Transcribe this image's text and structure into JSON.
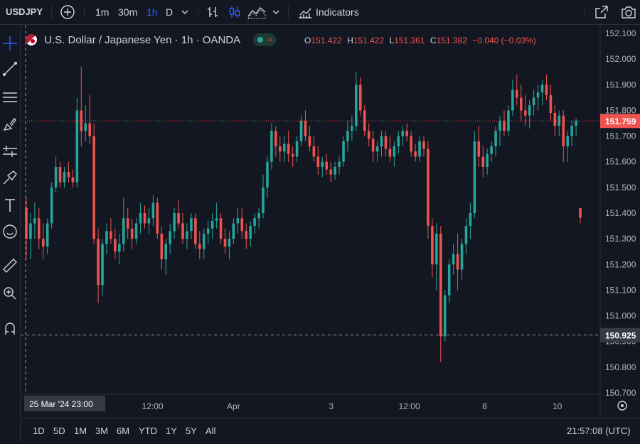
{
  "toolbar": {
    "symbol": "USDJPY",
    "intervals": [
      "1m",
      "30m",
      "1h",
      "D"
    ],
    "active_interval": "1h",
    "indicators_label": "Indicators"
  },
  "legend": {
    "title": "U.S. Dollar / Japanese Yen · 1h · OANDA",
    "o_label": "O",
    "o_value": "151.422",
    "h_label": "H",
    "h_value": "151.422",
    "l_label": "L",
    "l_value": "151.361",
    "c_label": "C",
    "c_value": "151.382",
    "change": "−0.040 (−0.03%)",
    "badge_icon": "≈"
  },
  "bottombar": {
    "ranges": [
      "1D",
      "5D",
      "1M",
      "3M",
      "6M",
      "YTD",
      "1Y",
      "5Y",
      "All"
    ],
    "clock": "21:57:08 (UTC)"
  },
  "colors": {
    "background": "#131722",
    "up": "#26a69a",
    "down": "#ef5350",
    "text": "#d1d4dc",
    "accent": "#2962ff"
  },
  "chart_data": {
    "type": "candlestick",
    "symbol": "USDJPY",
    "interval": "1h",
    "ylim": [
      150.7,
      152.1
    ],
    "yticks": [
      "152.100",
      "152.000",
      "151.900",
      "151.800",
      "151.700",
      "151.600",
      "151.500",
      "151.400",
      "151.300",
      "151.200",
      "151.100",
      "151.000",
      "150.900",
      "150.800",
      "150.700"
    ],
    "xticks": [
      "12:00",
      "Apr",
      "3",
      "12:00",
      "8",
      "10"
    ],
    "crosshair_x_label": "25 Mar '24  23:00",
    "crosshair_y_label": "150.925",
    "crosshair_price": 150.925,
    "last_price_label": "151.759",
    "last_price": 151.759,
    "grid": false,
    "candles": [
      [
        151.42,
        151.46,
        151.22,
        151.3
      ],
      [
        151.3,
        151.4,
        151.22,
        151.36
      ],
      [
        151.36,
        151.44,
        151.3,
        151.38
      ],
      [
        151.38,
        151.42,
        151.26,
        151.3
      ],
      [
        151.3,
        151.36,
        151.22,
        151.27
      ],
      [
        151.27,
        151.38,
        151.24,
        151.36
      ],
      [
        151.36,
        151.52,
        151.34,
        151.5
      ],
      [
        151.5,
        151.62,
        151.48,
        151.58
      ],
      [
        151.58,
        151.6,
        151.5,
        151.52
      ],
      [
        151.52,
        151.58,
        151.5,
        151.56
      ],
      [
        151.56,
        151.6,
        151.52,
        151.54
      ],
      [
        151.54,
        151.57,
        151.5,
        151.52
      ],
      [
        151.52,
        151.85,
        151.5,
        151.8
      ],
      [
        151.8,
        151.97,
        151.66,
        151.72
      ],
      [
        151.72,
        151.82,
        151.68,
        151.75
      ],
      [
        151.75,
        151.86,
        151.67,
        151.7
      ],
      [
        151.7,
        151.75,
        151.28,
        151.3
      ],
      [
        151.3,
        151.34,
        151.05,
        151.12
      ],
      [
        151.12,
        151.3,
        151.08,
        151.28
      ],
      [
        151.28,
        151.36,
        151.24,
        151.33
      ],
      [
        151.33,
        151.38,
        151.28,
        151.3
      ],
      [
        151.3,
        151.34,
        151.22,
        151.25
      ],
      [
        151.25,
        151.32,
        151.2,
        151.28
      ],
      [
        151.28,
        151.46,
        151.25,
        151.38
      ],
      [
        151.38,
        151.42,
        151.3,
        151.34
      ],
      [
        151.34,
        151.38,
        151.26,
        151.3
      ],
      [
        151.3,
        151.38,
        151.28,
        151.36
      ],
      [
        151.36,
        151.44,
        151.32,
        151.4
      ],
      [
        151.4,
        151.43,
        151.34,
        151.36
      ],
      [
        151.36,
        151.42,
        151.32,
        151.38
      ],
      [
        151.38,
        151.47,
        151.35,
        151.44
      ],
      [
        151.44,
        151.46,
        151.3,
        151.32
      ],
      [
        151.32,
        151.35,
        151.18,
        151.22
      ],
      [
        151.22,
        151.3,
        151.16,
        151.28
      ],
      [
        151.28,
        151.36,
        151.24,
        151.33
      ],
      [
        151.33,
        151.42,
        151.3,
        151.4
      ],
      [
        151.4,
        151.45,
        151.34,
        151.36
      ],
      [
        151.36,
        151.4,
        151.28,
        151.3
      ],
      [
        151.3,
        151.36,
        151.26,
        151.33
      ],
      [
        151.33,
        151.4,
        151.3,
        151.38
      ],
      [
        151.38,
        151.4,
        151.26,
        151.28
      ],
      [
        151.28,
        151.33,
        151.22,
        151.26
      ],
      [
        151.26,
        151.34,
        151.22,
        151.32
      ],
      [
        151.32,
        151.37,
        151.28,
        151.34
      ],
      [
        151.34,
        151.4,
        151.3,
        151.37
      ],
      [
        151.37,
        151.44,
        151.34,
        151.38
      ],
      [
        151.38,
        151.4,
        151.28,
        151.3
      ],
      [
        151.3,
        151.34,
        151.24,
        151.27
      ],
      [
        151.27,
        151.33,
        151.22,
        151.3
      ],
      [
        151.3,
        151.38,
        151.28,
        151.36
      ],
      [
        151.36,
        151.42,
        151.32,
        151.38
      ],
      [
        151.38,
        151.42,
        151.3,
        151.33
      ],
      [
        151.33,
        151.36,
        151.26,
        151.3
      ],
      [
        151.3,
        151.37,
        151.27,
        151.35
      ],
      [
        151.35,
        151.4,
        151.32,
        151.38
      ],
      [
        151.38,
        151.42,
        151.34,
        151.4
      ],
      [
        151.4,
        151.55,
        151.38,
        151.5
      ],
      [
        151.5,
        151.62,
        151.46,
        151.6
      ],
      [
        151.6,
        151.75,
        151.57,
        151.72
      ],
      [
        151.72,
        151.74,
        151.62,
        151.66
      ],
      [
        151.66,
        151.7,
        151.6,
        151.64
      ],
      [
        151.64,
        151.7,
        151.6,
        151.67
      ],
      [
        151.67,
        151.72,
        151.6,
        151.63
      ],
      [
        151.63,
        151.66,
        151.58,
        151.62
      ],
      [
        151.62,
        151.7,
        151.6,
        151.68
      ],
      [
        151.68,
        151.78,
        151.66,
        151.76
      ],
      [
        151.76,
        151.8,
        151.68,
        151.7
      ],
      [
        151.7,
        151.74,
        151.64,
        151.66
      ],
      [
        151.66,
        151.7,
        151.6,
        151.62
      ],
      [
        151.62,
        151.66,
        151.55,
        151.58
      ],
      [
        151.58,
        151.62,
        151.54,
        151.6
      ],
      [
        151.6,
        151.63,
        151.55,
        151.57
      ],
      [
        151.57,
        151.6,
        151.52,
        151.55
      ],
      [
        151.55,
        151.6,
        151.53,
        151.58
      ],
      [
        151.58,
        151.62,
        151.55,
        151.6
      ],
      [
        151.6,
        151.7,
        151.58,
        151.68
      ],
      [
        151.68,
        151.76,
        151.64,
        151.72
      ],
      [
        151.72,
        151.78,
        151.68,
        151.74
      ],
      [
        151.74,
        151.95,
        151.72,
        151.9
      ],
      [
        151.9,
        151.93,
        151.78,
        151.8
      ],
      [
        151.8,
        151.82,
        151.7,
        151.72
      ],
      [
        151.72,
        151.75,
        151.66,
        151.69
      ],
      [
        151.69,
        151.72,
        151.6,
        151.64
      ],
      [
        151.64,
        151.68,
        151.6,
        151.66
      ],
      [
        151.66,
        151.72,
        151.62,
        151.7
      ],
      [
        151.7,
        151.72,
        151.62,
        151.65
      ],
      [
        151.65,
        151.7,
        151.6,
        151.62
      ],
      [
        151.62,
        151.68,
        151.58,
        151.66
      ],
      [
        151.66,
        151.72,
        151.63,
        151.7
      ],
      [
        151.7,
        151.74,
        151.66,
        151.72
      ],
      [
        151.72,
        151.75,
        151.68,
        151.7
      ],
      [
        151.7,
        151.72,
        151.62,
        151.64
      ],
      [
        151.64,
        151.67,
        151.6,
        151.62
      ],
      [
        151.62,
        151.7,
        151.6,
        151.68
      ],
      [
        151.68,
        151.7,
        151.62,
        151.65
      ],
      [
        151.65,
        151.68,
        151.3,
        151.35
      ],
      [
        151.35,
        151.38,
        151.15,
        151.2
      ],
      [
        151.2,
        151.36,
        151.1,
        151.32
      ],
      [
        151.32,
        151.35,
        150.82,
        150.92
      ],
      [
        150.92,
        151.1,
        150.9,
        151.08
      ],
      [
        151.08,
        151.22,
        151.05,
        151.2
      ],
      [
        151.2,
        151.28,
        151.16,
        151.24
      ],
      [
        151.24,
        151.32,
        151.1,
        151.18
      ],
      [
        151.18,
        151.3,
        151.14,
        151.28
      ],
      [
        151.28,
        151.38,
        151.24,
        151.35
      ],
      [
        151.35,
        151.44,
        151.3,
        151.4
      ],
      [
        151.4,
        151.72,
        151.38,
        151.68
      ],
      [
        151.68,
        151.74,
        151.58,
        151.62
      ],
      [
        151.62,
        151.66,
        151.54,
        151.58
      ],
      [
        151.58,
        151.65,
        151.55,
        151.63
      ],
      [
        151.63,
        151.68,
        151.6,
        151.66
      ],
      [
        151.66,
        151.74,
        151.62,
        151.72
      ],
      [
        151.72,
        151.78,
        151.66,
        151.76
      ],
      [
        151.76,
        151.8,
        151.7,
        151.72
      ],
      [
        151.72,
        151.82,
        151.7,
        151.8
      ],
      [
        151.8,
        151.92,
        151.78,
        151.88
      ],
      [
        151.88,
        151.94,
        151.82,
        151.85
      ],
      [
        151.85,
        151.9,
        151.76,
        151.8
      ],
      [
        151.8,
        151.86,
        151.74,
        151.78
      ],
      [
        151.78,
        151.84,
        151.73,
        151.82
      ],
      [
        151.82,
        151.88,
        151.78,
        151.85
      ],
      [
        151.85,
        151.9,
        151.8,
        151.87
      ],
      [
        151.87,
        151.92,
        151.82,
        151.9
      ],
      [
        151.9,
        151.94,
        151.84,
        151.86
      ],
      [
        151.86,
        151.9,
        151.76,
        151.79
      ],
      [
        151.79,
        151.82,
        151.7,
        151.74
      ],
      [
        151.74,
        151.8,
        151.7,
        151.78
      ],
      [
        151.78,
        151.8,
        151.6,
        151.66
      ],
      [
        151.66,
        151.72,
        151.6,
        151.7
      ],
      [
        151.7,
        151.76,
        151.66,
        151.74
      ],
      [
        151.74,
        151.77,
        151.7,
        151.76
      ],
      [
        151.42,
        151.42,
        151.36,
        151.382
      ]
    ]
  }
}
